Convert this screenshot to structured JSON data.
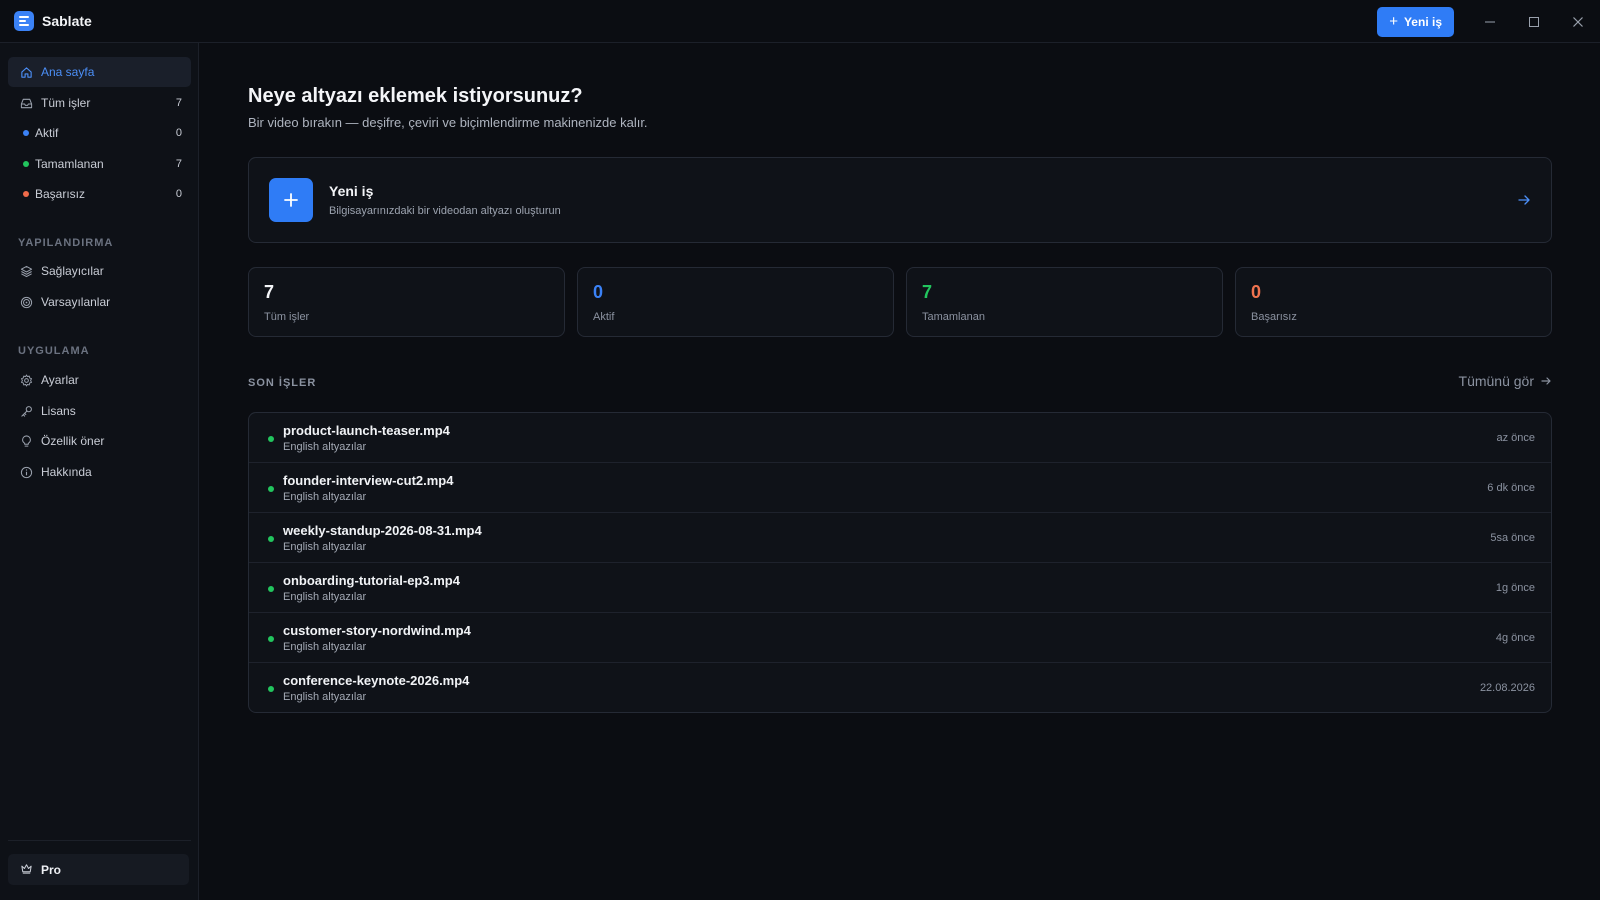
{
  "app": {
    "name": "Sablate"
  },
  "titlebar": {
    "new_job_label": "Yeni iş",
    "minimize": "minimize",
    "maximize": "maximize",
    "close": "close"
  },
  "sidebar": {
    "items": [
      {
        "label": "Ana sayfa",
        "icon": "home-icon",
        "active": true
      },
      {
        "label": "Tüm işler",
        "icon": "inbox-icon",
        "count": "7"
      },
      {
        "label": "Aktif",
        "icon": "dot",
        "count": "0",
        "color": "#3b82f6"
      },
      {
        "label": "Tamamlanan",
        "icon": "dot",
        "count": "7",
        "color": "#22c55e"
      },
      {
        "label": "Başarısız",
        "icon": "dot",
        "count": "0",
        "color": "#ef6b4a"
      }
    ],
    "section_config": "YAPILANDIRMA",
    "config_items": [
      {
        "label": "Sağlayıcılar",
        "icon": "layers-icon"
      },
      {
        "label": "Varsayılanlar",
        "icon": "target-icon"
      }
    ],
    "section_app": "UYGULAMA",
    "app_items": [
      {
        "label": "Ayarlar",
        "icon": "gear-icon"
      },
      {
        "label": "Lisans",
        "icon": "key-icon"
      },
      {
        "label": "Özellik öner",
        "icon": "lightbulb-icon"
      },
      {
        "label": "Hakkında",
        "icon": "info-icon"
      }
    ],
    "pro": {
      "label": "Pro",
      "icon": "crown-icon"
    }
  },
  "main": {
    "heading": "Neye altyazı eklemek istiyorsunuz?",
    "subheading": "Bir video bırakın — deşifre, çeviri ve biçimlendirme makinenizde kalır.",
    "new_card": {
      "title": "Yeni iş",
      "subtitle": "Bilgisayarınızdaki bir videodan altyazı oluşturun"
    },
    "stats": [
      {
        "value": "7",
        "label": "Tüm işler",
        "color": "#f4f5f8"
      },
      {
        "value": "0",
        "label": "Aktif",
        "color": "#3b82f6"
      },
      {
        "value": "7",
        "label": "Tamamlanan",
        "color": "#22c55e"
      },
      {
        "value": "0",
        "label": "Başarısız",
        "color": "#f0734f"
      }
    ],
    "recent_title": "SON İŞLER",
    "see_all": "Tümünü gör",
    "jobs": [
      {
        "name": "product-launch-teaser.mp4",
        "sub": "English altyazılar",
        "time": "az önce"
      },
      {
        "name": "founder-interview-cut2.mp4",
        "sub": "English altyazılar",
        "time": "6 dk önce"
      },
      {
        "name": "weekly-standup-2026-08-31.mp4",
        "sub": "English altyazılar",
        "time": "5sa önce"
      },
      {
        "name": "onboarding-tutorial-ep3.mp4",
        "sub": "English altyazılar",
        "time": "1g önce"
      },
      {
        "name": "customer-story-nordwind.mp4",
        "sub": "English altyazılar",
        "time": "4g önce"
      },
      {
        "name": "conference-keynote-2026.mp4",
        "sub": "English altyazılar",
        "time": "22.08.2026"
      }
    ]
  }
}
